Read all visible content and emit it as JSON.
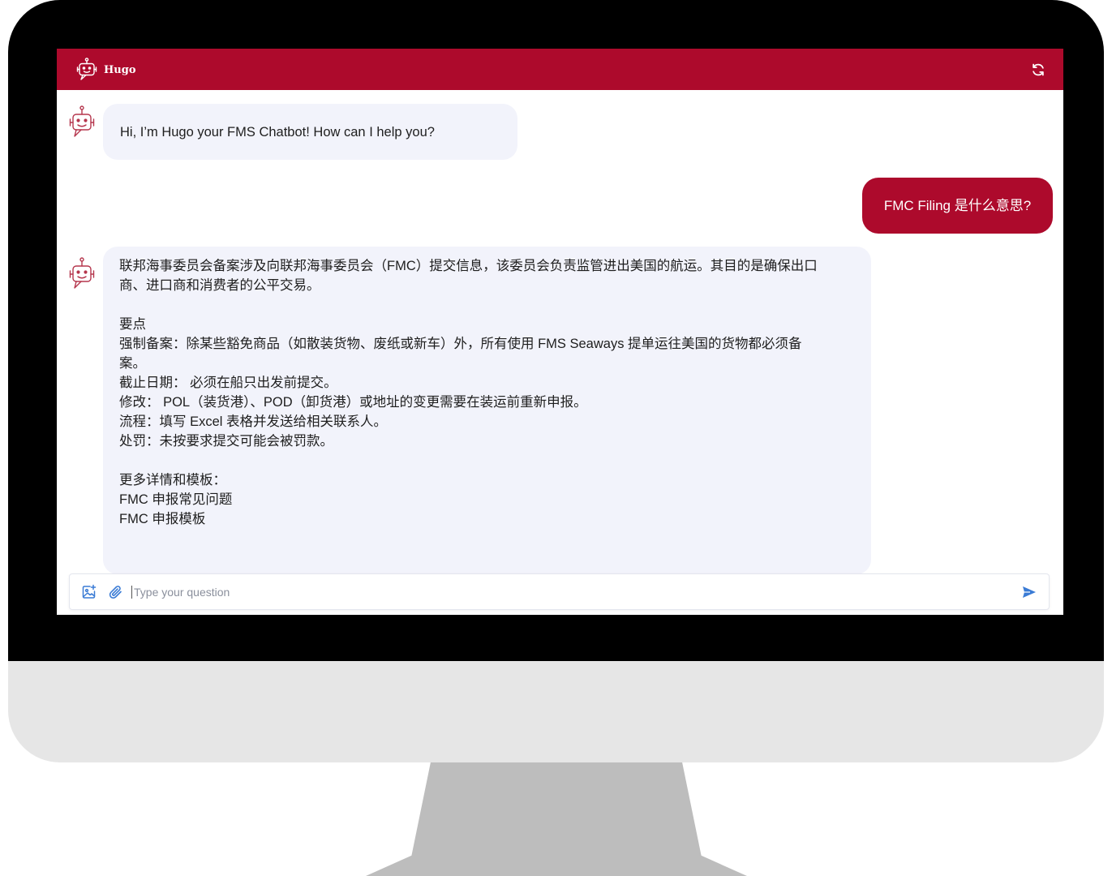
{
  "app": {
    "title": "Hugo",
    "brand_color": "#ad0a2c",
    "logo_icon": "robot-icon",
    "refresh_icon": "refresh-icon"
  },
  "messages": {
    "greeting": "Hi, I’m Hugo your FMS Chatbot! How can I help you?",
    "user_question": "FMC Filing 是什么意思?",
    "answer": {
      "intro_line1": "联邦海事委员会备案涉及向联邦海事委员会（FMC）提交信息，该委员会负责监管进出美国的航运。其目的是确保出口",
      "intro_line2": "商、进口商和消费者的公平交易。",
      "key_points_title": "要点",
      "point1_line1": "强制备案：除某些豁免商品（如散装货物、废纸或新车）外，所有使用 FMS Seaways 提单运往美国的货物都必须备",
      "point1_line2": "案。",
      "point2": "截止日期： 必须在船只出发前提交。",
      "point3": "修改： POL（装货港）、POD（卸货港）或地址的变更需要在装运前重新申报。",
      "point4": "流程：填写 Excel 表格并发送给相关联系人。",
      "point5": "处罚：未按要求提交可能会被罚款。",
      "more_title": "更多详情和模板：",
      "link_faq": "FMC 申报常见问题",
      "link_template": "FMC 申报模板"
    }
  },
  "input": {
    "placeholder": "Type your question",
    "value": "",
    "image_upload_icon": "image-upload-icon",
    "attach_icon": "paperclip-icon",
    "send_icon": "send-icon",
    "icon_color": "#3a7bd5"
  }
}
